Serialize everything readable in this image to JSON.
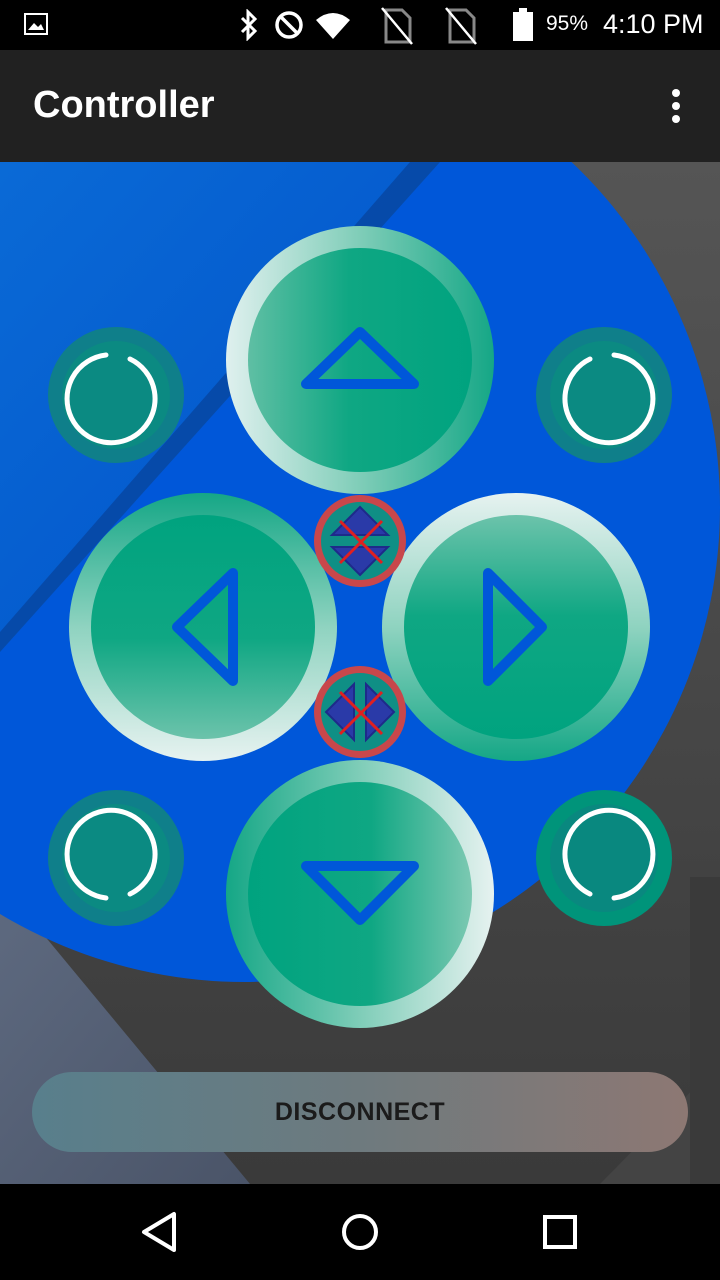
{
  "status_bar": {
    "battery_percent": "95%",
    "time": "4:10 PM",
    "icons": [
      "image-notification-icon",
      "bluetooth-icon",
      "do-not-disturb-icon",
      "wifi-icon",
      "no-sim-icon",
      "no-sim-icon",
      "battery-icon"
    ]
  },
  "app_bar": {
    "title": "Controller",
    "menu_icon": "more-vert-icon"
  },
  "controller": {
    "buttons": [
      {
        "name": "rotate-up-left-button",
        "icon": "rotate-icon"
      },
      {
        "name": "forward-button",
        "icon": "arrow-up-icon"
      },
      {
        "name": "rotate-up-right-button",
        "icon": "rotate-icon"
      },
      {
        "name": "left-button",
        "icon": "arrow-left-icon"
      },
      {
        "name": "right-button",
        "icon": "arrow-right-icon"
      },
      {
        "name": "rotate-down-left-button",
        "icon": "rotate-icon"
      },
      {
        "name": "backward-button",
        "icon": "arrow-down-icon"
      },
      {
        "name": "rotate-down-right-button",
        "icon": "rotate-icon"
      },
      {
        "name": "vertical-stop-button",
        "icon": "vertical-stop-icon"
      },
      {
        "name": "horizontal-stop-button",
        "icon": "horizontal-stop-icon"
      }
    ],
    "colors": {
      "accent_blue": "#0057d9",
      "button_green": "#00a884",
      "stop_ring_red": "#c8474b"
    }
  },
  "disconnect_button": {
    "label": "DISCONNECT"
  },
  "nav_bar": {
    "icons": [
      "back-icon",
      "home-icon",
      "recents-icon"
    ]
  }
}
